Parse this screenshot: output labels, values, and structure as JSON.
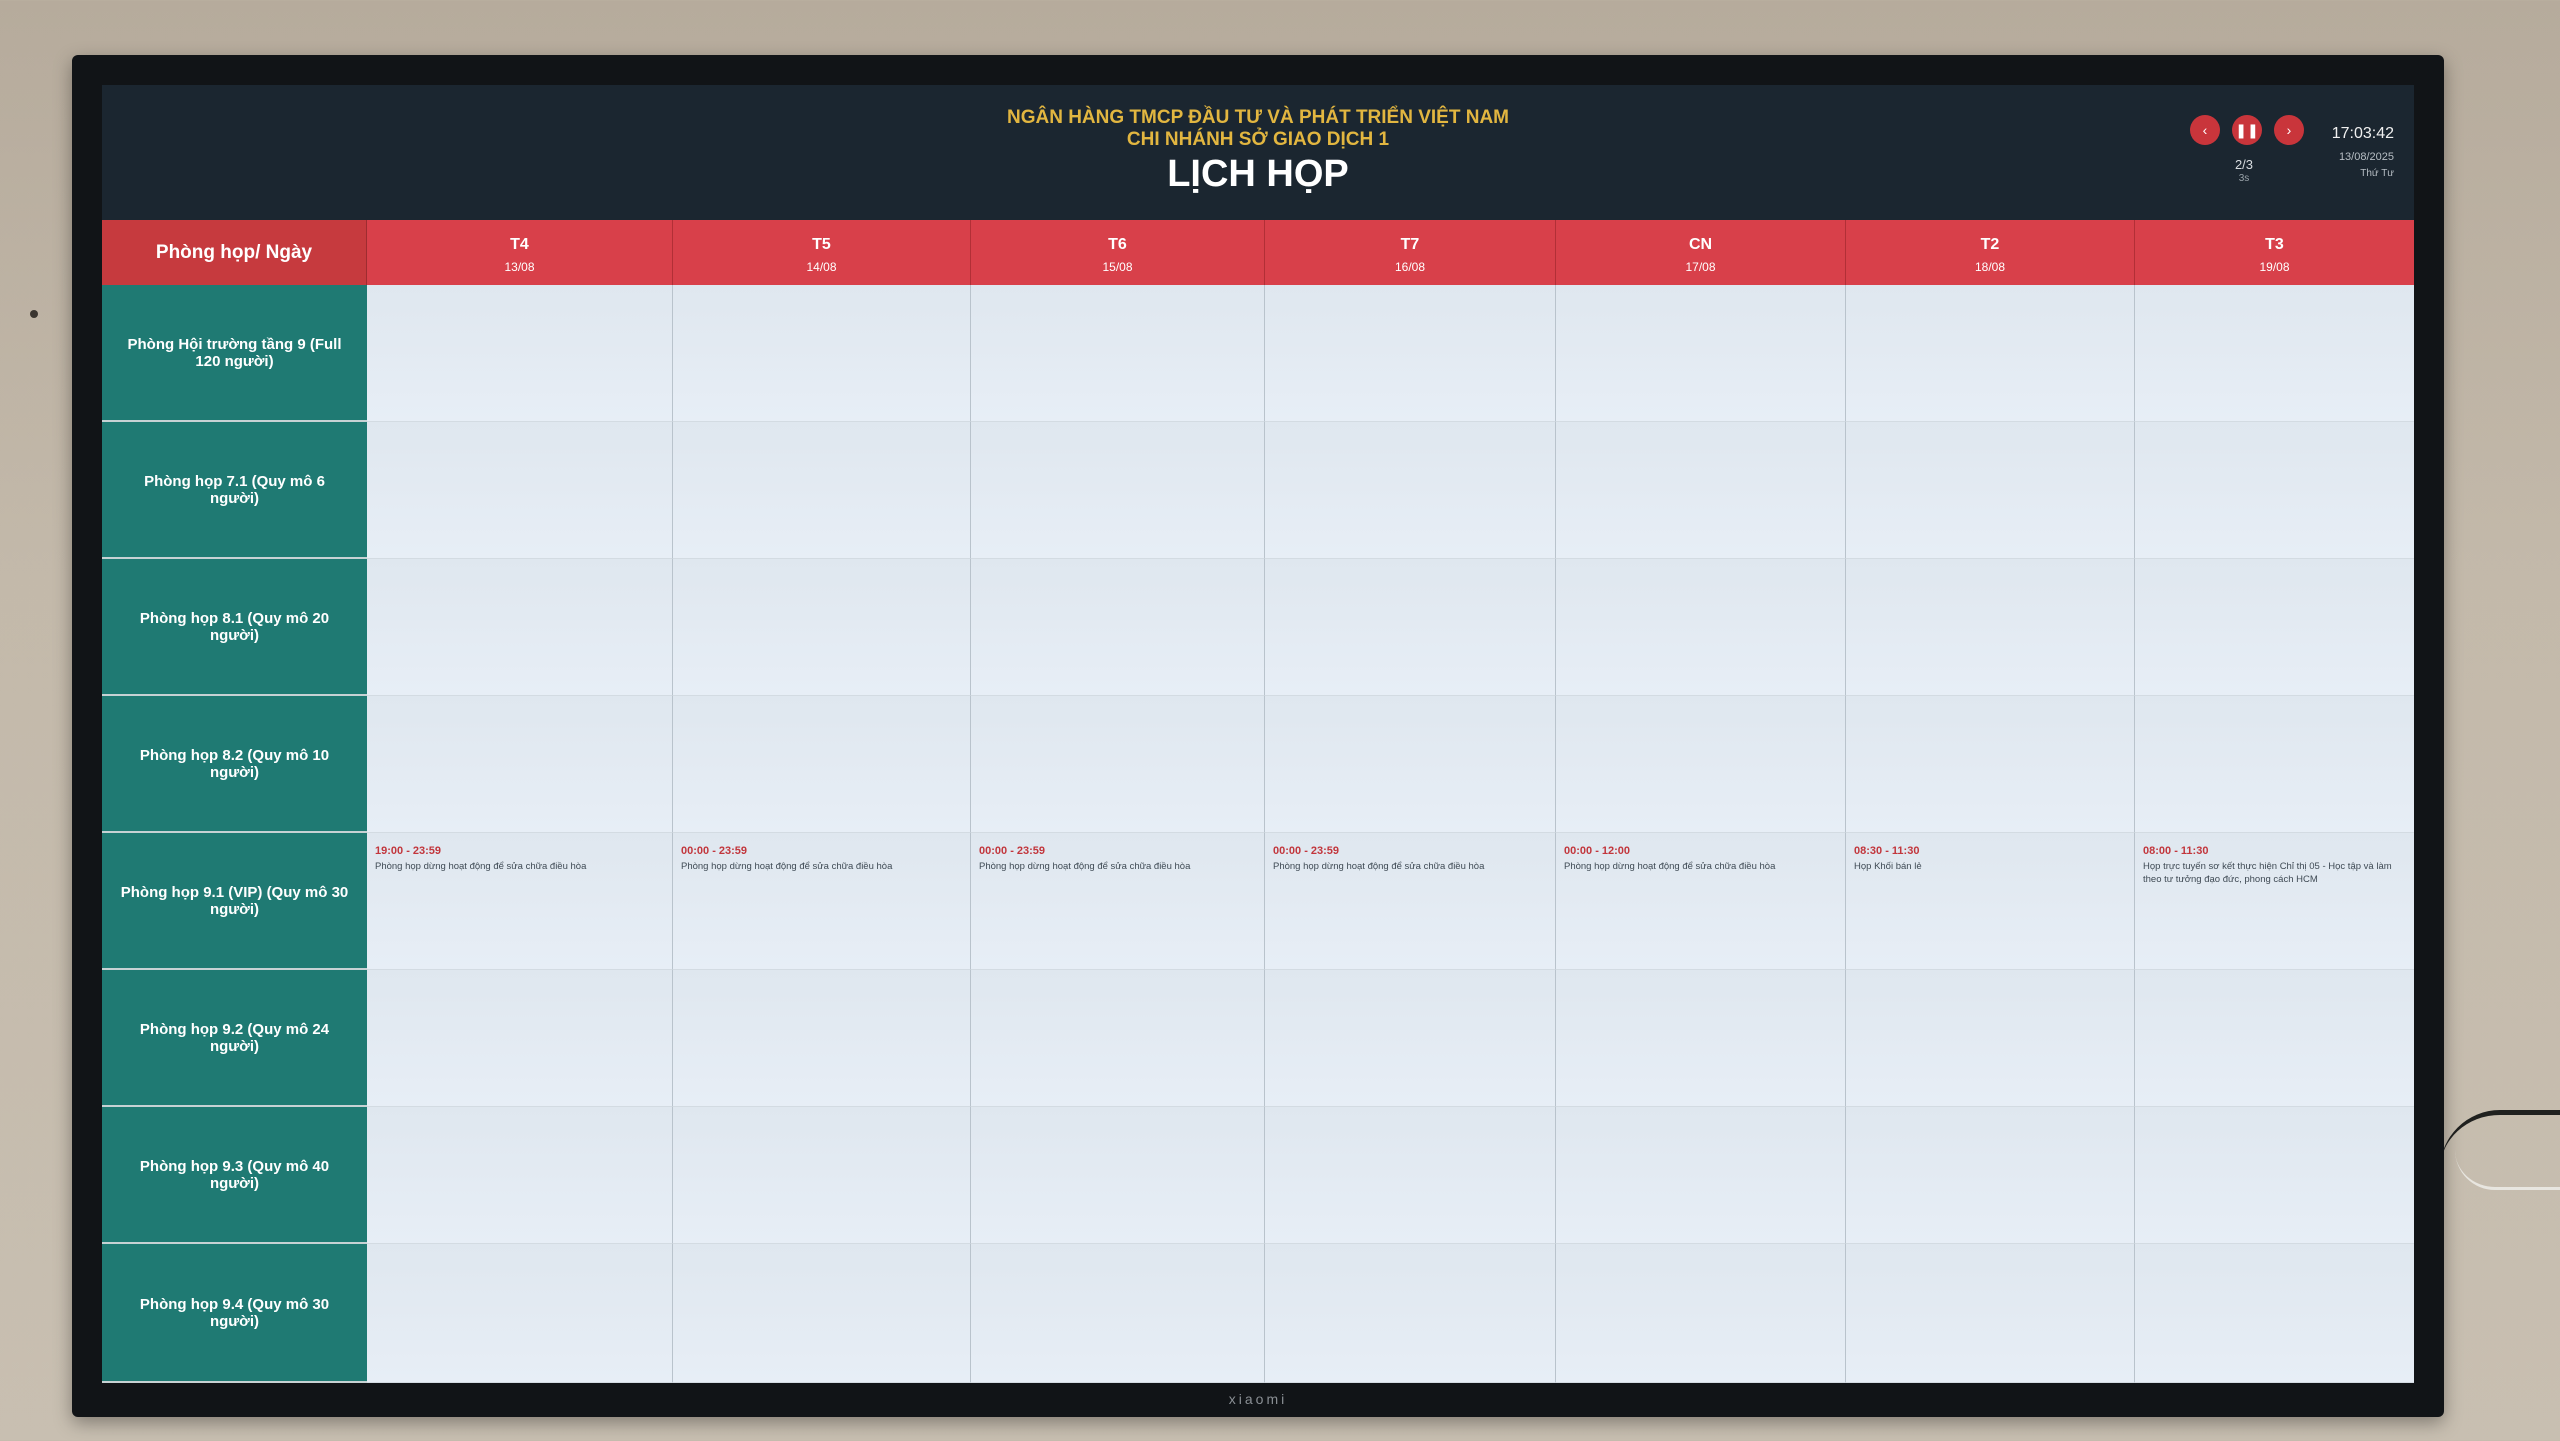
{
  "header": {
    "org_line1": "NGÂN HÀNG TMCP ĐẦU TƯ VÀ PHÁT TRIỂN VIỆT NAM",
    "org_line2": "CHI NHÁNH SỞ GIAO DỊCH 1",
    "title": "LỊCH HỌP",
    "controls": {
      "prev": "‹",
      "pause": "❚❚",
      "next": "›"
    },
    "page_indicator": "2/3",
    "page_sub": "3s",
    "clock_time": "17:03:42",
    "clock_date": "13/08/2025",
    "clock_weekday": "Thứ Tư"
  },
  "grid": {
    "corner_label": "Phòng họp/ Ngày",
    "days": [
      {
        "name": "T4",
        "date": "13/08"
      },
      {
        "name": "T5",
        "date": "14/08"
      },
      {
        "name": "T6",
        "date": "15/08"
      },
      {
        "name": "T7",
        "date": "16/08"
      },
      {
        "name": "CN",
        "date": "17/08"
      },
      {
        "name": "T2",
        "date": "18/08"
      },
      {
        "name": "T3",
        "date": "19/08"
      }
    ],
    "rooms": [
      "Phòng Hội trường tầng 9 (Full 120 người)",
      "Phòng họp 7.1 (Quy mô 6 người)",
      "Phòng họp 8.1 (Quy mô 20 người)",
      "Phòng họp 8.2 (Quy mô 10 người)",
      "Phòng họp 9.1 (VIP) (Quy mô 30 người)",
      "Phòng họp 9.2 (Quy mô 24 người)",
      "Phòng họp 9.3 (Quy mô 40 người)",
      "Phòng họp 9.4 (Quy mô 30 người)"
    ],
    "events_row_9_1": [
      {
        "time": "19:00 - 23:59",
        "title": "Phòng họp dừng hoạt động để sửa chữa điều hòa"
      },
      {
        "time": "00:00 - 23:59",
        "title": "Phòng họp dừng hoạt động để sửa chữa điều hòa"
      },
      {
        "time": "00:00 - 23:59",
        "title": "Phòng họp dừng hoạt động để sửa chữa điều hòa"
      },
      {
        "time": "00:00 - 23:59",
        "title": "Phòng họp dừng hoạt động để sửa chữa điều hòa"
      },
      {
        "time": "00:00 - 12:00",
        "title": "Phòng họp dừng hoạt động để sửa chữa điều hòa"
      },
      {
        "time": "08:30 - 11:30",
        "title": "Họp Khối bán lẻ"
      },
      {
        "time": "08:00 - 11:30",
        "title": "Họp trực tuyến sơ kết thực hiện Chỉ thị 05 - Học tập và làm theo tư tưởng đạo đức, phong cách HCM"
      }
    ]
  },
  "tv": {
    "brand": "xiaomi"
  },
  "colors": {
    "header_bg": "#1b2630",
    "day_header": "#d8404a",
    "room_col": "#1f7a73",
    "org_text": "#e2b640",
    "event_time": "#c2363c"
  }
}
